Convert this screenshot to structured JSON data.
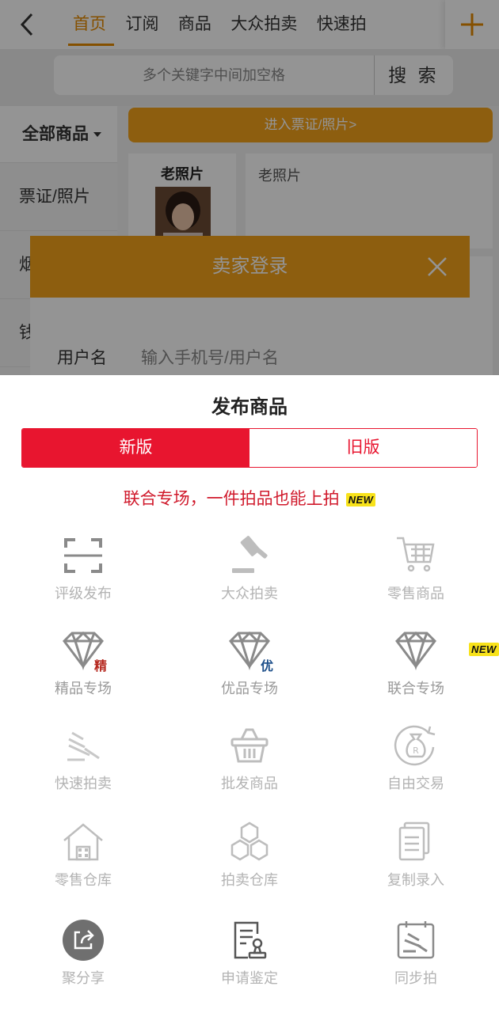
{
  "nav": {
    "tabs": [
      {
        "label": "首页"
      },
      {
        "label": "订阅"
      },
      {
        "label": "商品"
      },
      {
        "label": "大众拍卖"
      },
      {
        "label": "快速拍"
      }
    ]
  },
  "search": {
    "placeholder": "多个关键字中间加空格",
    "button_label": "搜 索"
  },
  "sidebar": {
    "items": [
      {
        "label": "全部商品"
      },
      {
        "label": "票证/照片"
      },
      {
        "label": "烟"
      },
      {
        "label": "钱"
      }
    ]
  },
  "content": {
    "enter_label": "进入票证/照片>",
    "card_left_title": "老照片",
    "card_right_text": "老照片"
  },
  "login_dialog": {
    "title": "卖家登录",
    "username_label": "用户名",
    "username_placeholder": "输入手机号/用户名"
  },
  "sheet": {
    "title": "发布商品",
    "segments": [
      {
        "label": "新版",
        "selected": true
      },
      {
        "label": "旧版",
        "selected": false
      }
    ],
    "promo_text": "联合专场，一件拍品也能上拍",
    "new_badge": "NEW",
    "items": [
      {
        "label": "评级发布",
        "icon": "scan-icon"
      },
      {
        "label": "大众拍卖",
        "icon": "gavel-icon"
      },
      {
        "label": "零售商品",
        "icon": "cart-icon"
      },
      {
        "label": "精品专场",
        "icon": "diamond-icon",
        "tag": "精"
      },
      {
        "label": "优品专场",
        "icon": "diamond-icon",
        "tag": "优"
      },
      {
        "label": "联合专场",
        "icon": "diamond-icon",
        "badge": "NEW"
      },
      {
        "label": "快速拍卖",
        "icon": "fast-gavel-icon"
      },
      {
        "label": "批发商品",
        "icon": "basket-icon"
      },
      {
        "label": "自由交易",
        "icon": "money-bag-icon"
      },
      {
        "label": "零售仓库",
        "icon": "warehouse-icon"
      },
      {
        "label": "拍卖仓库",
        "icon": "boxes-icon"
      },
      {
        "label": "复制录入",
        "icon": "copy-doc-icon"
      },
      {
        "label": "聚分享",
        "icon": "share-icon"
      },
      {
        "label": "申请鉴定",
        "icon": "appraisal-icon"
      },
      {
        "label": "同步拍",
        "icon": "sync-auction-icon"
      }
    ]
  },
  "colors": {
    "accent_orange": "#f3a21a",
    "tab_active": "#e58a00",
    "brand_red": "#e8152f",
    "promo_red": "#d0192b",
    "new_yellow": "#f8e21a"
  }
}
